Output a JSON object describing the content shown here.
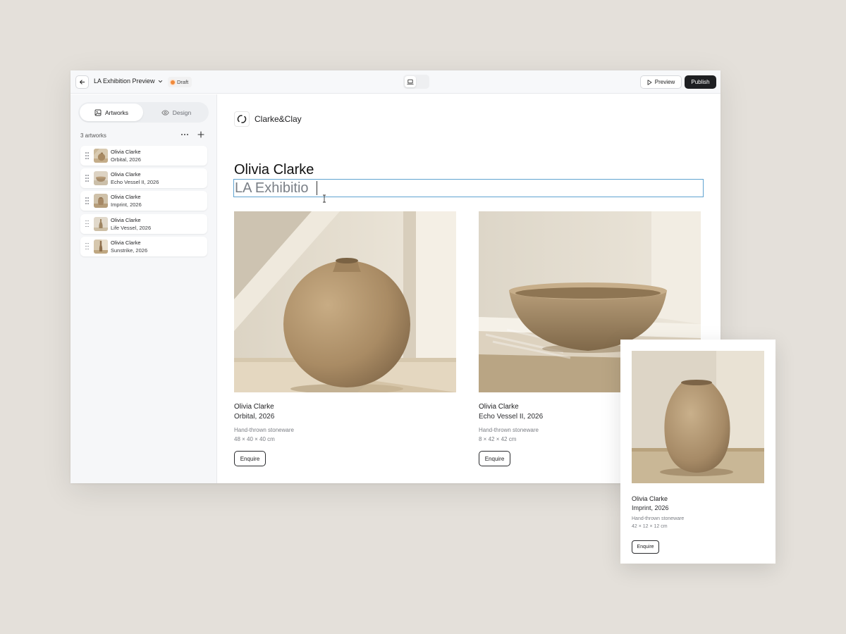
{
  "toolbar": {
    "project_title": "LA Exhibition Preview",
    "status_badge": "Draft",
    "preview_label": "Preview",
    "publish_label": "Publish",
    "device_modes": [
      "desktop",
      "mobile"
    ],
    "selected_device": "desktop"
  },
  "sidebar": {
    "tabs": [
      {
        "label": "Artworks",
        "icon": "image-icon",
        "active": true
      },
      {
        "label": "Design",
        "icon": "eye-icon",
        "active": false
      }
    ],
    "count_label": "3 artworks",
    "items": [
      {
        "artist": "Olivia Clarke",
        "title": "Orbital, 2026"
      },
      {
        "artist": "Olivia Clarke",
        "title": "Echo Vessel II, 2026"
      },
      {
        "artist": "Olivia Clarke",
        "title": "Imprint, 2026"
      },
      {
        "artist": "Olivia Clarke",
        "title": "Life Vessel, 2026"
      },
      {
        "artist": "Olivia Clarke",
        "title": "Sunstrike, 2026"
      }
    ]
  },
  "canvas": {
    "brand_name": "Clarke&Clay",
    "artist_heading": "Olivia Clarke",
    "exhibition_title_value": "LA Exhibitio",
    "cards": [
      {
        "artist": "Olivia Clarke",
        "title": "Orbital, 2026",
        "medium": "Hand-thrown stoneware",
        "dimensions": "48 × 40 × 40 cm",
        "button": "Enquire"
      },
      {
        "artist": "Olivia Clarke",
        "title": "Echo Vessel II, 2026",
        "medium": "Hand-thrown stoneware",
        "dimensions": "8 × 42 × 42 cm",
        "button": "Enquire"
      }
    ]
  },
  "mobile_preview": {
    "artist": "Olivia Clarke",
    "title": "Imprint, 2026",
    "medium": "Hand-thrown stoneware",
    "dimensions": "42 × 12 × 12 cm",
    "button": "Enquire"
  },
  "colors": {
    "background": "#e4e0da",
    "publish_button": "#1e1f22",
    "draft_dot": "#f08a3c",
    "edit_outline": "#5fa3d0"
  }
}
